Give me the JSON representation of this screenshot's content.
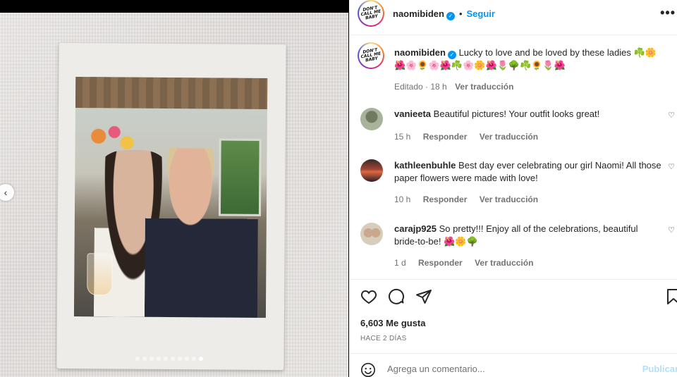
{
  "post": {
    "dots_count": 10,
    "active_dot": 9
  },
  "header": {
    "username": "naomibiden",
    "follow_label": "Seguir",
    "separator": "•",
    "more_label": "•••",
    "avatar_text": [
      "DON'T",
      "CALL ME",
      "BABY"
    ]
  },
  "caption": {
    "username": "naomibiden",
    "text": "Lucky to love and be loved by these ladies ☘️🌼",
    "emoji_line": "🌺🌸🌻🌸🌺☘️🌸🌼🌺🌷🌳☘️🌻🌷🌺",
    "edited": "Editado · 18 h",
    "translate": "Ver traducción"
  },
  "comments": [
    {
      "username": "vanieeta",
      "text": "Beautiful pictures! Your outfit looks great!",
      "time": "15 h",
      "reply": "Responder",
      "translate": "Ver traducción"
    },
    {
      "username": "kathleenbuhle",
      "text": "Best day ever celebrating our girl Naomi! All those paper flowers were made with love!",
      "time": "10 h",
      "reply": "Responder",
      "translate": "Ver traducción"
    },
    {
      "username": "carajp925",
      "text": "So pretty!!! Enjoy all of the celebrations, beautiful bride-to-be! 🌺🌼🌳",
      "time": "1 d",
      "reply": "Responder",
      "translate": "Ver traducción"
    }
  ],
  "actions": {
    "likes": "6,603 Me gusta",
    "date": "HACE 2 DÍAS"
  },
  "add_comment": {
    "placeholder": "Agrega un comentario...",
    "publish": "Publicar"
  },
  "colors": {
    "accent": "#0095f6",
    "text": "#262626",
    "muted": "#737373",
    "publish_disabled": "#b2dffc"
  },
  "icons": {
    "prev": "chevron-left-icon",
    "like": "heart-icon",
    "comment": "comment-icon",
    "share": "share-icon",
    "save": "bookmark-icon",
    "emoji": "emoji-icon",
    "more": "more-icon",
    "verified": "verified-icon"
  }
}
